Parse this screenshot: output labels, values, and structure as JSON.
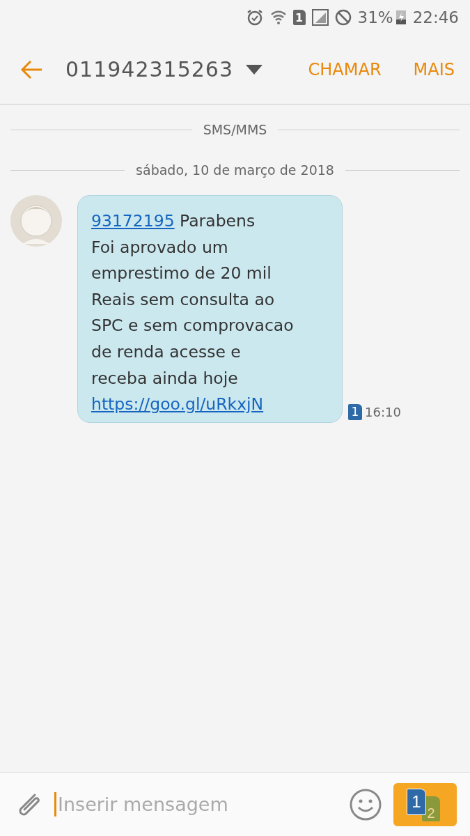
{
  "status_bar": {
    "sim_number": "1",
    "battery": "31%",
    "time": "22:46"
  },
  "header": {
    "contact": "011942315263",
    "actions": [
      "CHAMAR",
      "MAIS"
    ]
  },
  "dividers": [
    "SMS/MMS",
    "sábado, 10 de março de 2018"
  ],
  "messages": [
    {
      "phone_link": "93172195",
      "lines": [
        "Parabens",
        "Foi aprovado um",
        "emprestimo de 20 mil",
        "Reais sem consulta ao",
        "SPC e sem comprovacao",
        "de renda acesse e",
        "receba ainda hoje"
      ],
      "url": "https://goo.gl/uRkxjN",
      "sim_number": "1",
      "time": "16:10"
    }
  ],
  "compose": {
    "placeholder": "Inserir mensagem",
    "send_sims": [
      "1",
      "2"
    ]
  }
}
